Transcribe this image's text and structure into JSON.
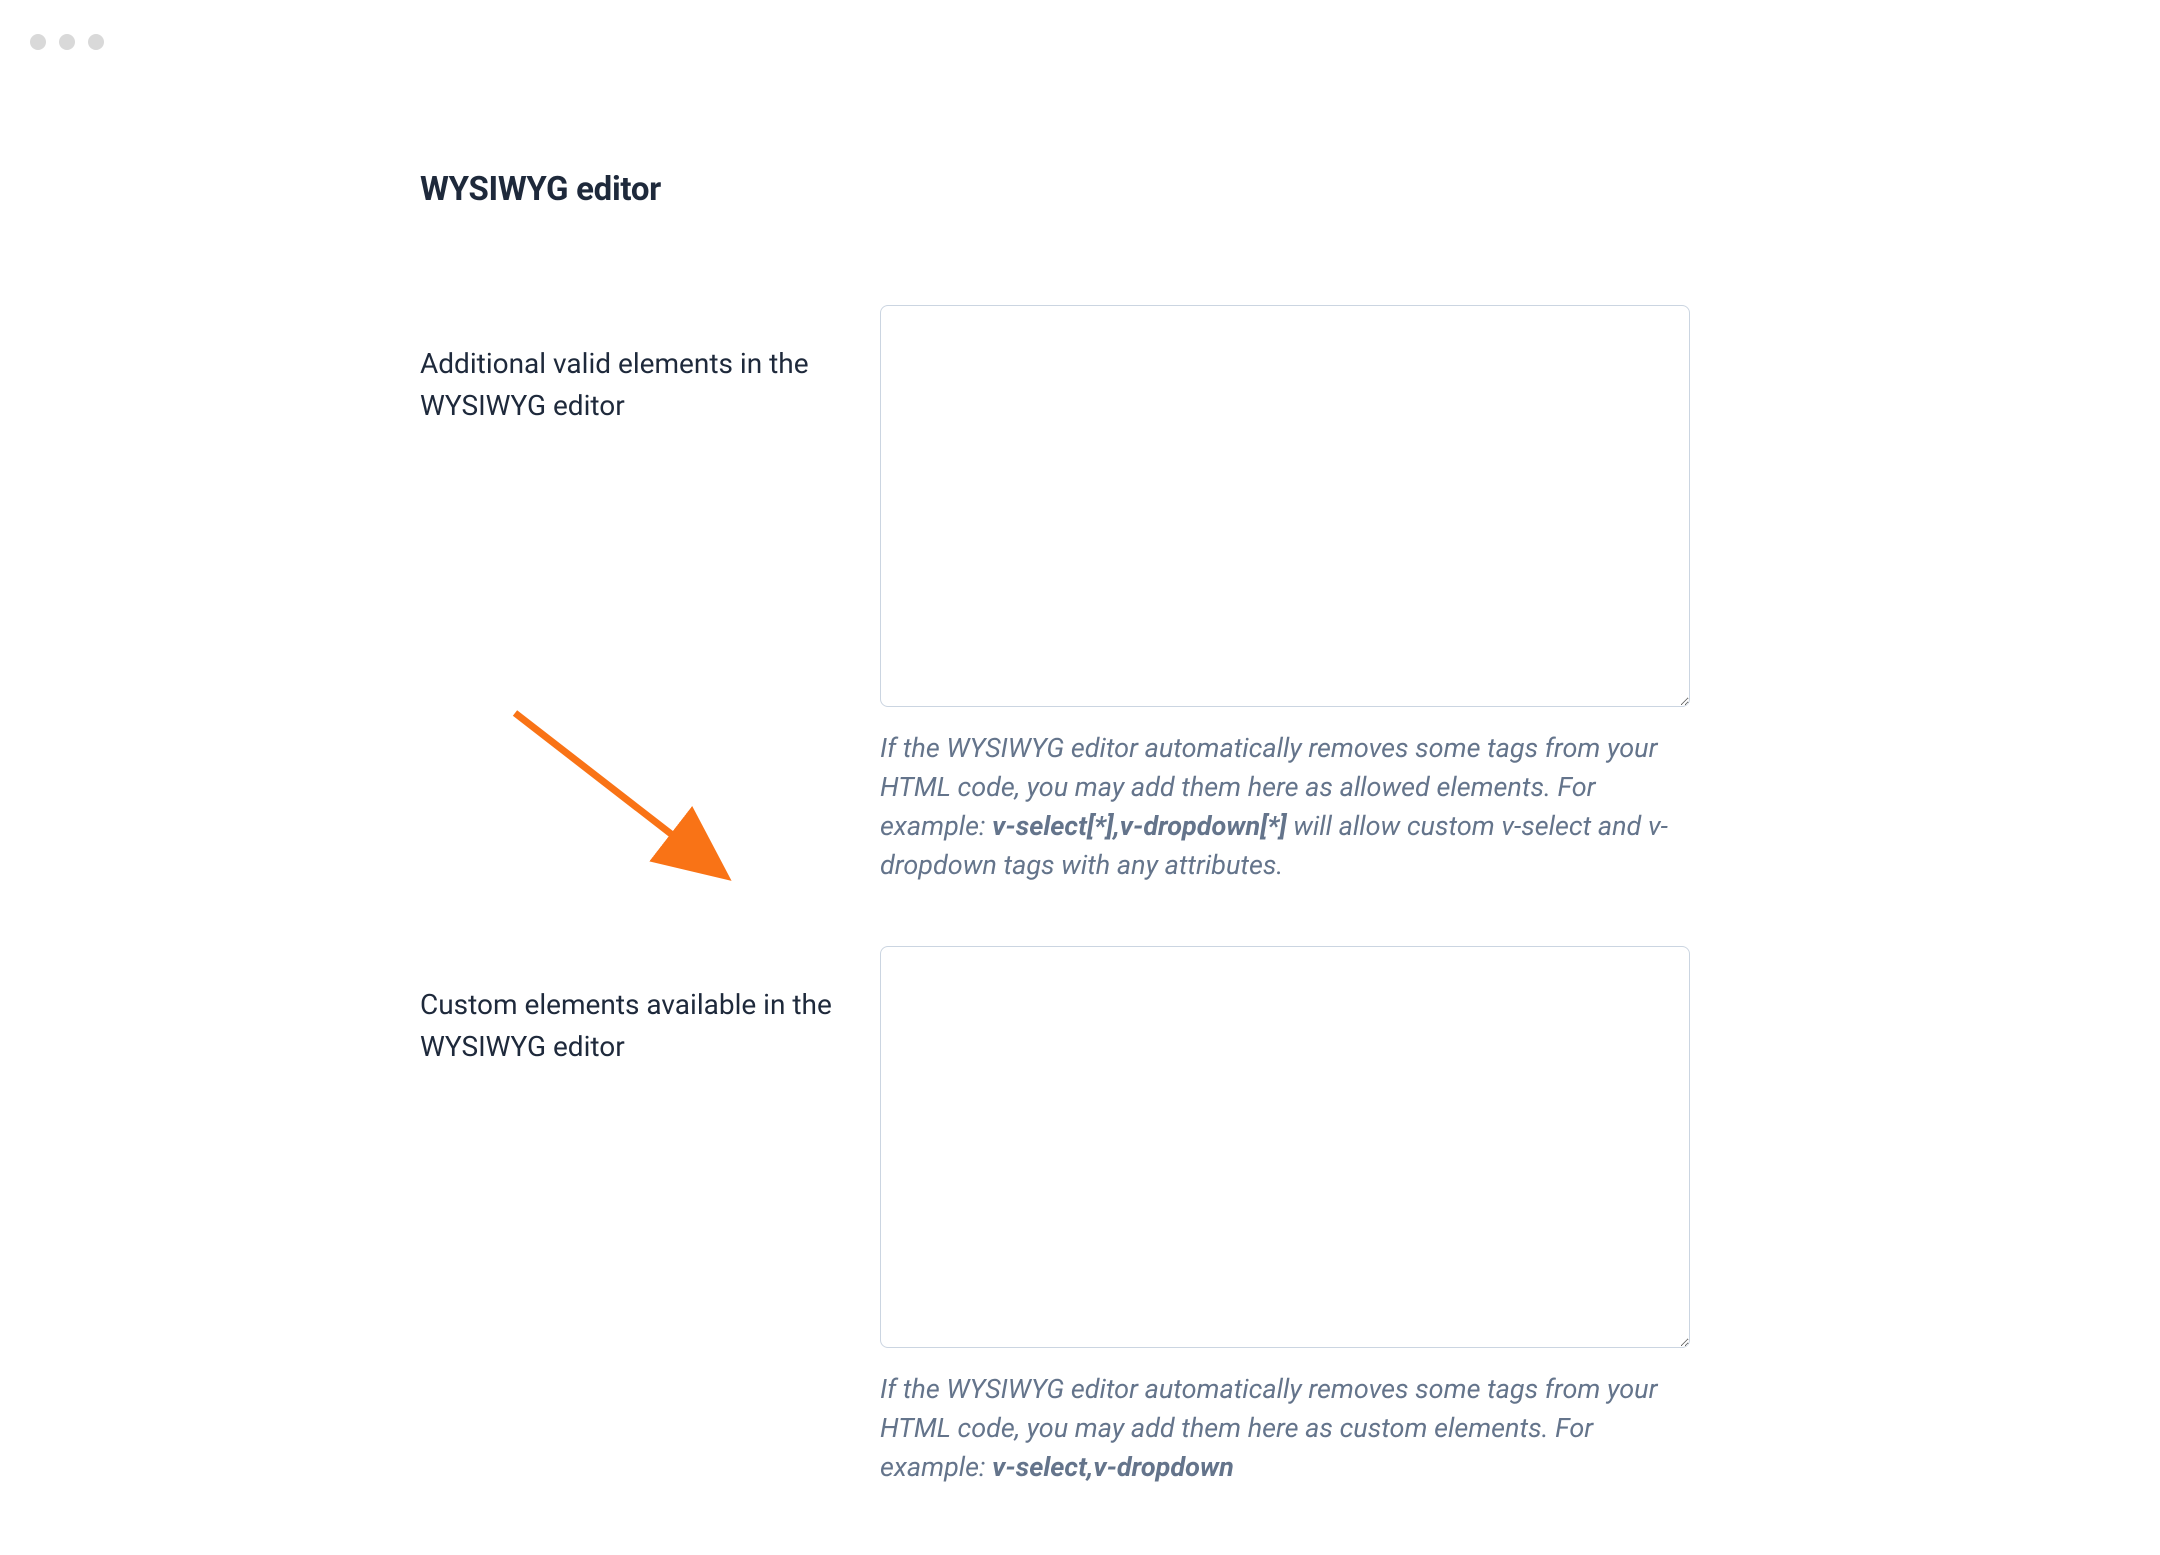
{
  "section": {
    "title": "WYSIWYG editor"
  },
  "fields": {
    "additional_elements": {
      "label": "Additional valid elements in the WYSIWYG editor",
      "value": "",
      "help_prefix": "If the WYSIWYG editor automatically removes some tags from your HTML code, you may add them here as allowed elements. For example: ",
      "help_bold": "v-select[*],v-dropdown[*]",
      "help_suffix": " will allow custom v-select and v-dropdown tags with any attributes."
    },
    "custom_elements": {
      "label": "Custom elements available in the WYSIWYG editor",
      "value": "",
      "help_prefix": "If the WYSIWYG editor automatically removes some tags from your HTML code, you may add them here as custom elements. For example: ",
      "help_bold": "v-select,v-dropdown",
      "help_suffix": ""
    }
  },
  "colors": {
    "arrow": "#f97316"
  }
}
